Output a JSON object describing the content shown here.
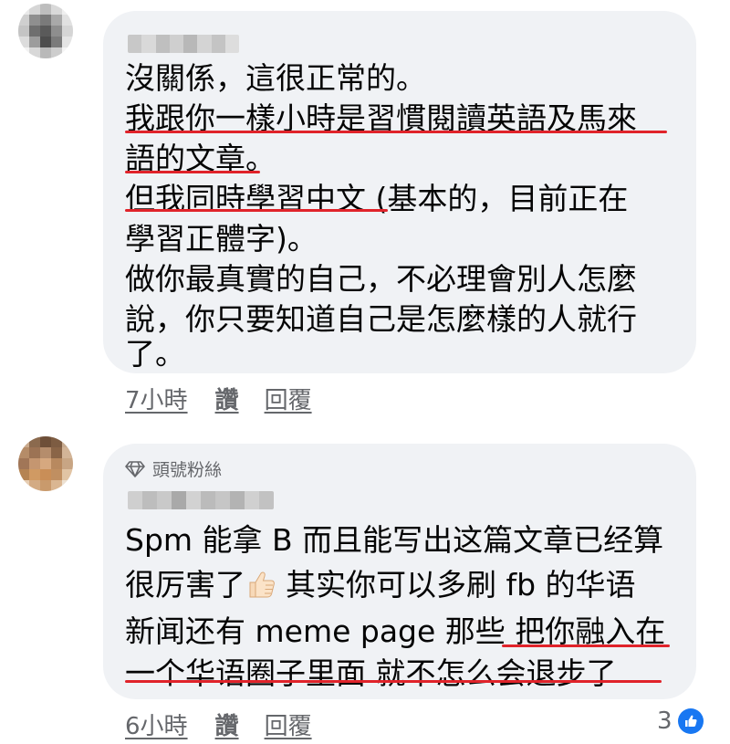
{
  "comment1": {
    "lines": [
      "沒關係，這很正常的。",
      "我跟你一樣小時是習慣閱讀英語及馬來",
      "語的文章。",
      "但我同時學習中文 (基本的，目前正在",
      "學習正體字)。",
      "做你最真實的自己，不必理會別人怎麼",
      "說，你只要知道自己是怎麼樣的人就行",
      "了。"
    ],
    "time": "7小時",
    "like": "讚",
    "reply": "回覆"
  },
  "comment2": {
    "badge": "頭號粉絲",
    "lines": [
      "Spm 能拿 B 而且能写出这篇文章已经算",
      "很厉害了",
      "其实你可以多刷 fb 的华语",
      "新闻还有 meme page 那些  把你融入在",
      "一个华语圈子里面 就不怎么会退步了"
    ],
    "time": "6小時",
    "like": "讚",
    "reply": "回覆",
    "reaction_count": "3"
  },
  "colors": {
    "bubble": "#f0f2f5",
    "annotation_underline": "#e0232a",
    "like_blue": "#1877f2",
    "meta_text": "#65676b"
  },
  "icons": [
    "diamond-icon",
    "thumbs-up-emoji",
    "like-reaction-icon"
  ]
}
